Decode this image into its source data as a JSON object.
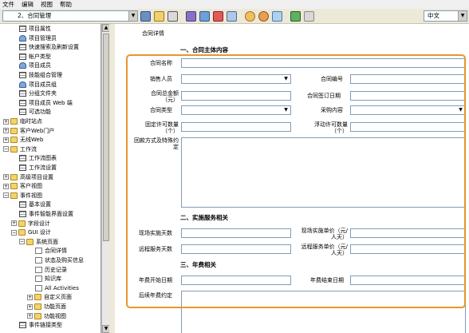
{
  "menu": [
    "文件",
    "编辑",
    "视图",
    "帮助"
  ],
  "toolbar": {
    "form_select": "2、合同管理",
    "lang_select": "中文"
  },
  "tree": [
    {
      "label": "项目属性",
      "icon": "grid-icon"
    },
    {
      "label": "项目管理员",
      "icon": "user-icon"
    },
    {
      "label": "快速搜索及刷新设置",
      "icon": "grid-icon"
    },
    {
      "label": "帐户类型",
      "icon": "grid-icon"
    },
    {
      "label": "项目成员",
      "icon": "user-icon"
    },
    {
      "label": "技能组合管理",
      "icon": "grid-icon"
    },
    {
      "label": "项目成员组",
      "icon": "user-icon"
    },
    {
      "label": "分组文件夹",
      "icon": "grid-icon"
    },
    {
      "label": "项目成员 Web 端",
      "icon": "grid-icon"
    },
    {
      "label": "可选功能",
      "icon": "grid-icon"
    },
    {
      "label": "临时站点",
      "icon": "folder-icon"
    },
    {
      "label": "客户Web门户",
      "icon": "folder-icon"
    },
    {
      "label": "无线Web",
      "icon": "folder-icon"
    },
    {
      "label": "工作流",
      "icon": "folder-icon"
    },
    {
      "label": "工作流图表",
      "icon": "grid-icon"
    },
    {
      "label": "工作流设置",
      "icon": "grid-icon"
    },
    {
      "label": "高级项目设置",
      "icon": "folder-icon"
    },
    {
      "label": "客户视图",
      "icon": "folder-icon"
    },
    {
      "label": "事件视图",
      "icon": "folder-icon"
    },
    {
      "label": "基本设置",
      "icon": "grid-icon"
    },
    {
      "label": "事件智能界面设置",
      "icon": "grid-icon"
    },
    {
      "label": "字段设计",
      "icon": "folder-icon"
    },
    {
      "label": "GUI 设计",
      "icon": "folder-icon"
    },
    {
      "label": "系统页面",
      "icon": "folder-icon"
    },
    {
      "label": "合同详情",
      "icon": "page-icon"
    },
    {
      "label": "状态及购买信息",
      "icon": "page-icon"
    },
    {
      "label": "历史记录",
      "icon": "page-icon"
    },
    {
      "label": "知识库",
      "icon": "page-icon"
    },
    {
      "label": "All Activities",
      "icon": "page-icon"
    },
    {
      "label": "自定义页面",
      "icon": "folder-icon"
    },
    {
      "label": "功能页面",
      "icon": "folder-icon"
    },
    {
      "label": "功能视图",
      "icon": "folder-icon"
    },
    {
      "label": "事件链接类型",
      "icon": "grid-icon"
    }
  ],
  "form": {
    "title": "合同详情",
    "sec1": "一、合同主体内容",
    "contract_name": "合同名称",
    "sales_person": "销售人员",
    "contract_no": "合同编号",
    "total_amount": "合同总金额（元）",
    "sign_date": "合同签订日期",
    "contract_type": "合同类型",
    "purchase_content": "采购内容",
    "fixed_license": "固定许可数量（个）",
    "floating_license": "浮动许可数量（个）",
    "payment_terms": "回款方式及特殊约定",
    "sec2": "二、实施服务相关",
    "onsite_days": "现场实施天数",
    "onsite_price": "现场实施单价（元/人天）",
    "remote_days": "远程服务天数",
    "remote_price": "远程服务单价（元/人天）",
    "sec3": "三、年费相关",
    "fee_start": "年费开始日期",
    "fee_end": "年费结束日期",
    "fee_terms": "后续年费约定"
  },
  "colors": {
    "highlight": "#e8962a",
    "input_border": "#7f9db9"
  }
}
